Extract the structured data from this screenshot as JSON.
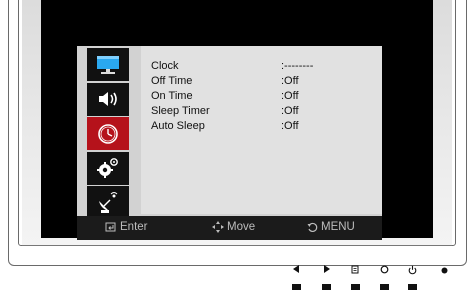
{
  "menu": {
    "icons": [
      {
        "name": "monitor-icon",
        "active": false
      },
      {
        "name": "speaker-icon",
        "active": false
      },
      {
        "name": "clock-icon",
        "active": true
      },
      {
        "name": "gears-icon",
        "active": false
      },
      {
        "name": "satellite-icon",
        "active": false
      }
    ],
    "items": [
      {
        "label": "Clock",
        "value": ":--------"
      },
      {
        "label": "Off Time",
        "value": ":Off"
      },
      {
        "label": "On Time",
        "value": ":Off"
      },
      {
        "label": "Sleep Timer",
        "value": ":Off"
      },
      {
        "label": "Auto Sleep",
        "value": ":Off"
      }
    ]
  },
  "footer": {
    "enter": "Enter",
    "move": "Move",
    "menu": "MENU"
  },
  "colors": {
    "active": "#b5121b",
    "panel": "#e1e1e1",
    "footer_bg": "#1b1b1b",
    "monitor_blue": "#2aa8f0"
  }
}
